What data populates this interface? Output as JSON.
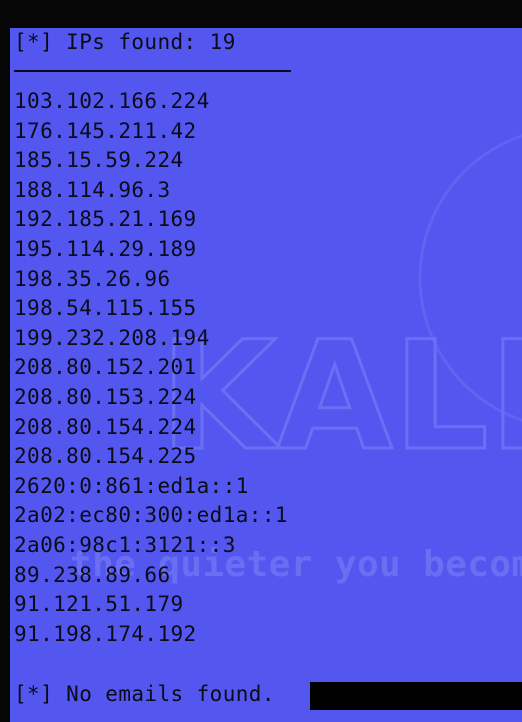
{
  "terminal": {
    "header": "[*] IPs found: 19",
    "ips": [
      "103.102.166.224",
      "176.145.211.42",
      "185.15.59.224",
      "188.114.96.3",
      "192.185.21.169",
      "195.114.29.189",
      "198.35.26.96",
      "198.54.115.155",
      "199.232.208.194",
      "208.80.152.201",
      "208.80.153.224",
      "208.80.154.224",
      "208.80.154.225",
      "2620:0:861:ed1a::1",
      "2a02:ec80:300:ed1a::1",
      "2a06:98c1:3121::3",
      "89.238.89.66",
      "91.121.51.179",
      "91.198.174.192"
    ],
    "footer": "[*] No emails found."
  },
  "wallpaper": {
    "logo_text": "KALI",
    "slogan": "the quieter you become"
  },
  "colors": {
    "terminal_background": "#5357f0",
    "text": "#0b0b1a",
    "outer_frame": "#060606"
  }
}
